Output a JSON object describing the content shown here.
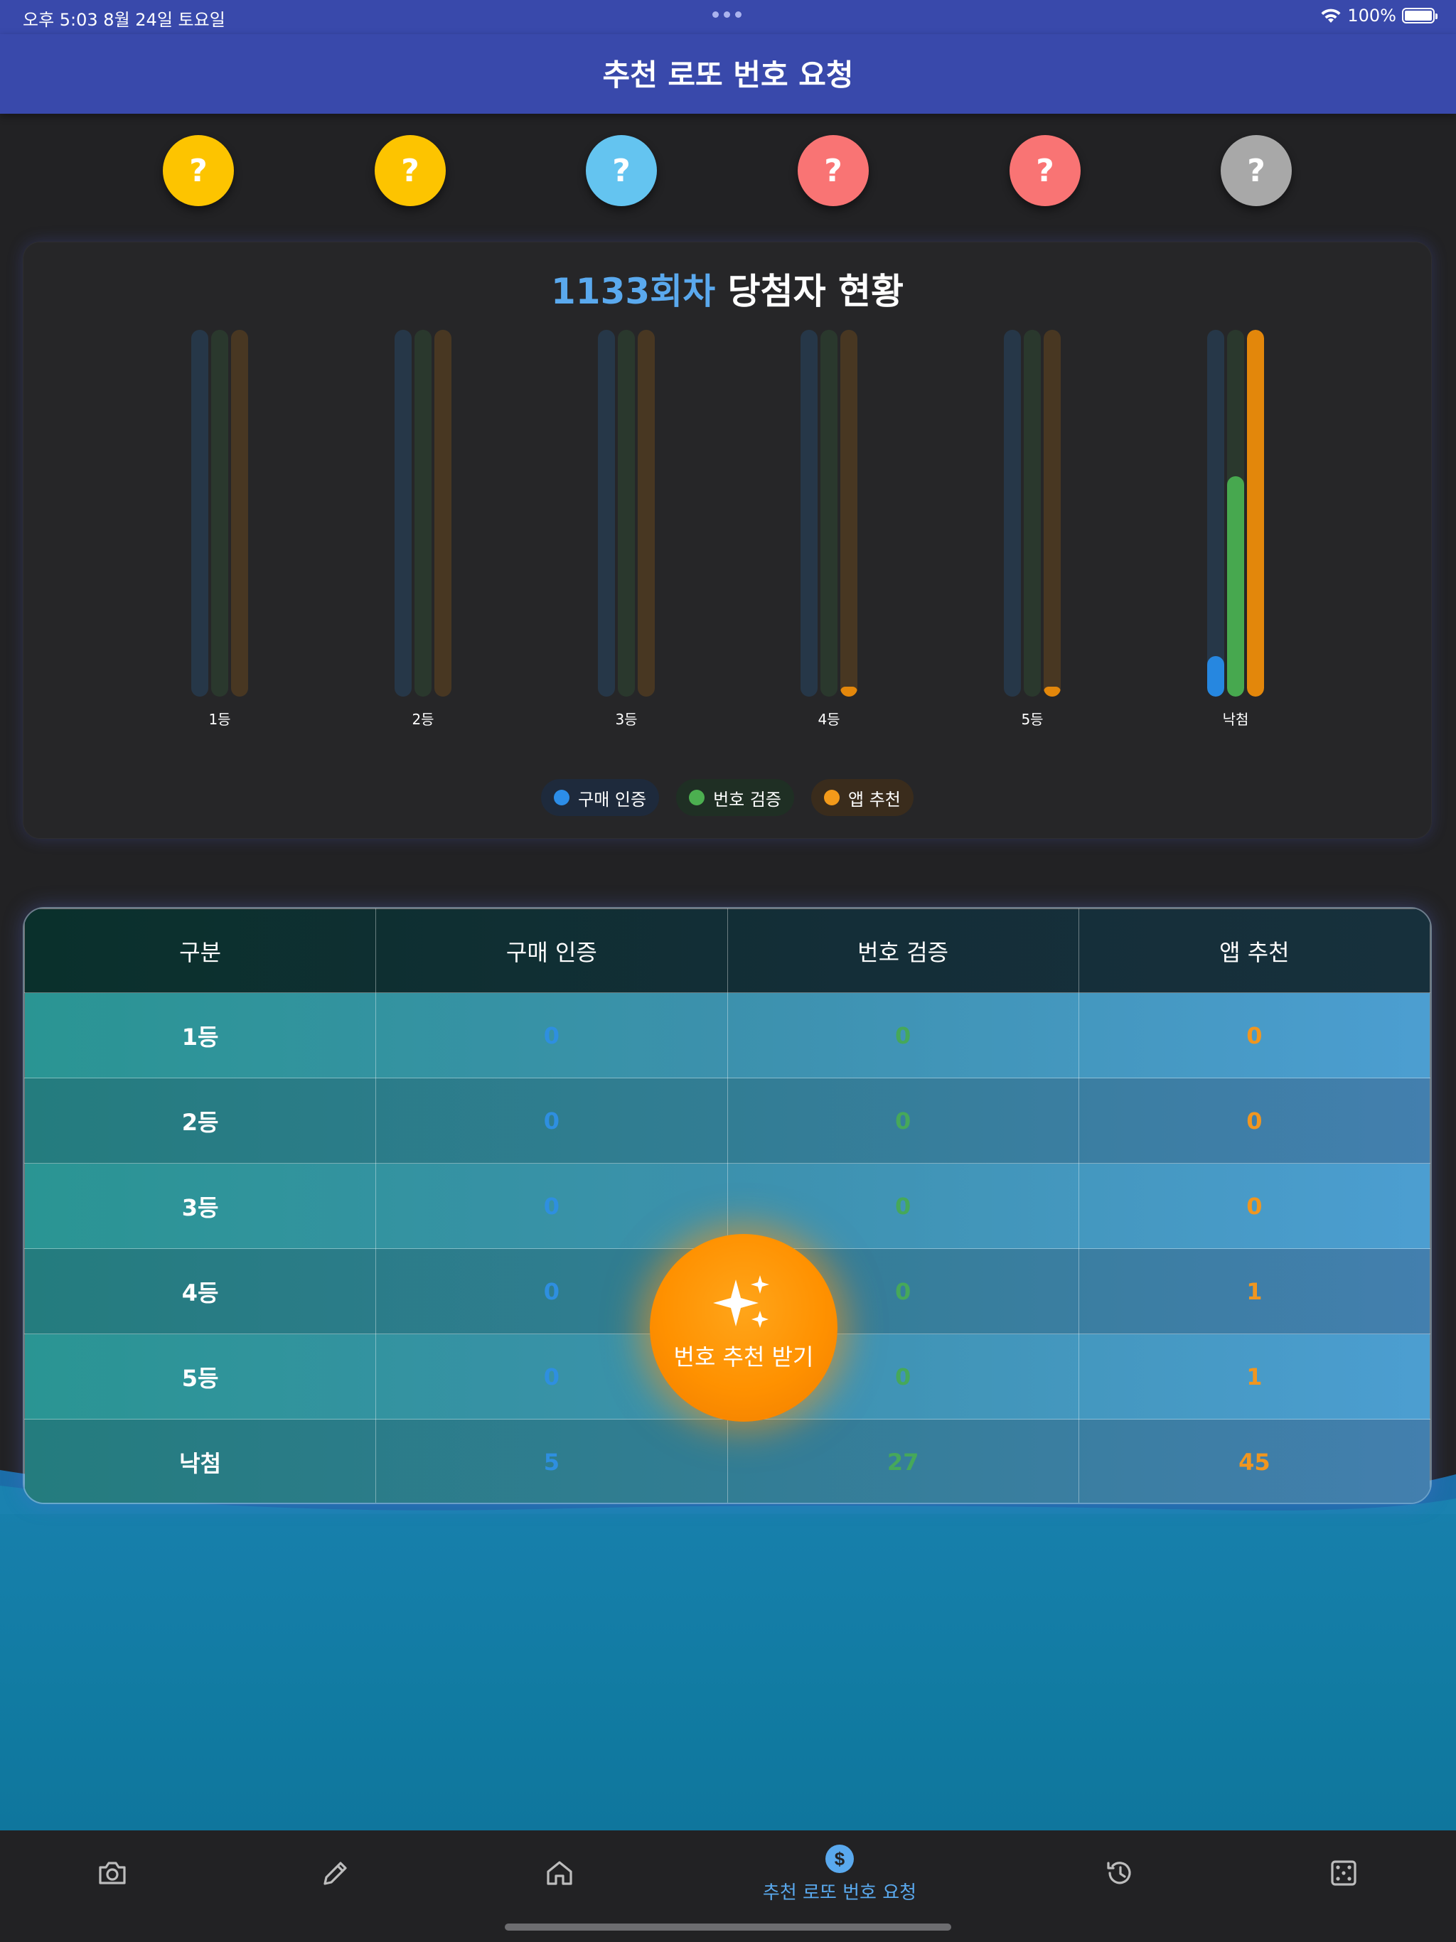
{
  "status_bar": {
    "time_date": "오후 5:03   8월 24일 토요일",
    "battery_text": "100%"
  },
  "header": {
    "title": "추천 로또 번호 요청"
  },
  "balls": [
    {
      "text": "?",
      "color": "#fdc400"
    },
    {
      "text": "?",
      "color": "#fdc400"
    },
    {
      "text": "?",
      "color": "#64c4f0"
    },
    {
      "text": "?",
      "color": "#f97474"
    },
    {
      "text": "?",
      "color": "#f97474"
    },
    {
      "text": "?",
      "color": "#a8a8a8"
    }
  ],
  "chart_card": {
    "title_accent": "1133회차",
    "title_rest": " 당첨자 현황"
  },
  "chart_data": {
    "type": "bar",
    "categories": [
      "1등",
      "2등",
      "3등",
      "4등",
      "5등",
      "낙첨"
    ],
    "series": [
      {
        "name": "구매 인증",
        "color": "#2687e0",
        "values": [
          0,
          0,
          0,
          0,
          0,
          5
        ]
      },
      {
        "name": "번호 검증",
        "color": "#47a84f",
        "values": [
          0,
          0,
          0,
          0,
          0,
          27
        ]
      },
      {
        "name": "앱 추천",
        "color": "#e3870b",
        "values": [
          0,
          0,
          0,
          1,
          1,
          45
        ]
      }
    ],
    "ylim": [
      0,
      45
    ]
  },
  "legend": [
    {
      "label": "구매 인증",
      "color": "#2c8de8",
      "bg": "#1e2a3c"
    },
    {
      "label": "번호 검증",
      "color": "#4caf50",
      "bg": "#1f2f24"
    },
    {
      "label": "앱 추천",
      "color": "#f39a1a",
      "bg": "#3a2c1c"
    }
  ],
  "table": {
    "headers": [
      "구분",
      "구매 인증",
      "번호 검증",
      "앱 추천"
    ],
    "rows": [
      {
        "rank": "1등",
        "purchase": "0",
        "verify": "0",
        "app": "0"
      },
      {
        "rank": "2등",
        "purchase": "0",
        "verify": "0",
        "app": "0"
      },
      {
        "rank": "3등",
        "purchase": "0",
        "verify": "0",
        "app": "0"
      },
      {
        "rank": "4등",
        "purchase": "0",
        "verify": "0",
        "app": "1"
      },
      {
        "rank": "5등",
        "purchase": "0",
        "verify": "0",
        "app": "1"
      },
      {
        "rank": "낙첨",
        "purchase": "5",
        "verify": "27",
        "app": "45"
      }
    ]
  },
  "fab": {
    "label": "번호 추천 받기",
    "icon": "sparkles-icon"
  },
  "bottom_nav": {
    "items": [
      {
        "icon": "camera-icon",
        "label": ""
      },
      {
        "icon": "pencil-icon",
        "label": ""
      },
      {
        "icon": "home-icon",
        "label": ""
      },
      {
        "icon": "dollar-icon",
        "label": "추천 로또 번호 요청",
        "active": true
      },
      {
        "icon": "history-icon",
        "label": ""
      },
      {
        "icon": "dice-icon",
        "label": ""
      }
    ]
  }
}
